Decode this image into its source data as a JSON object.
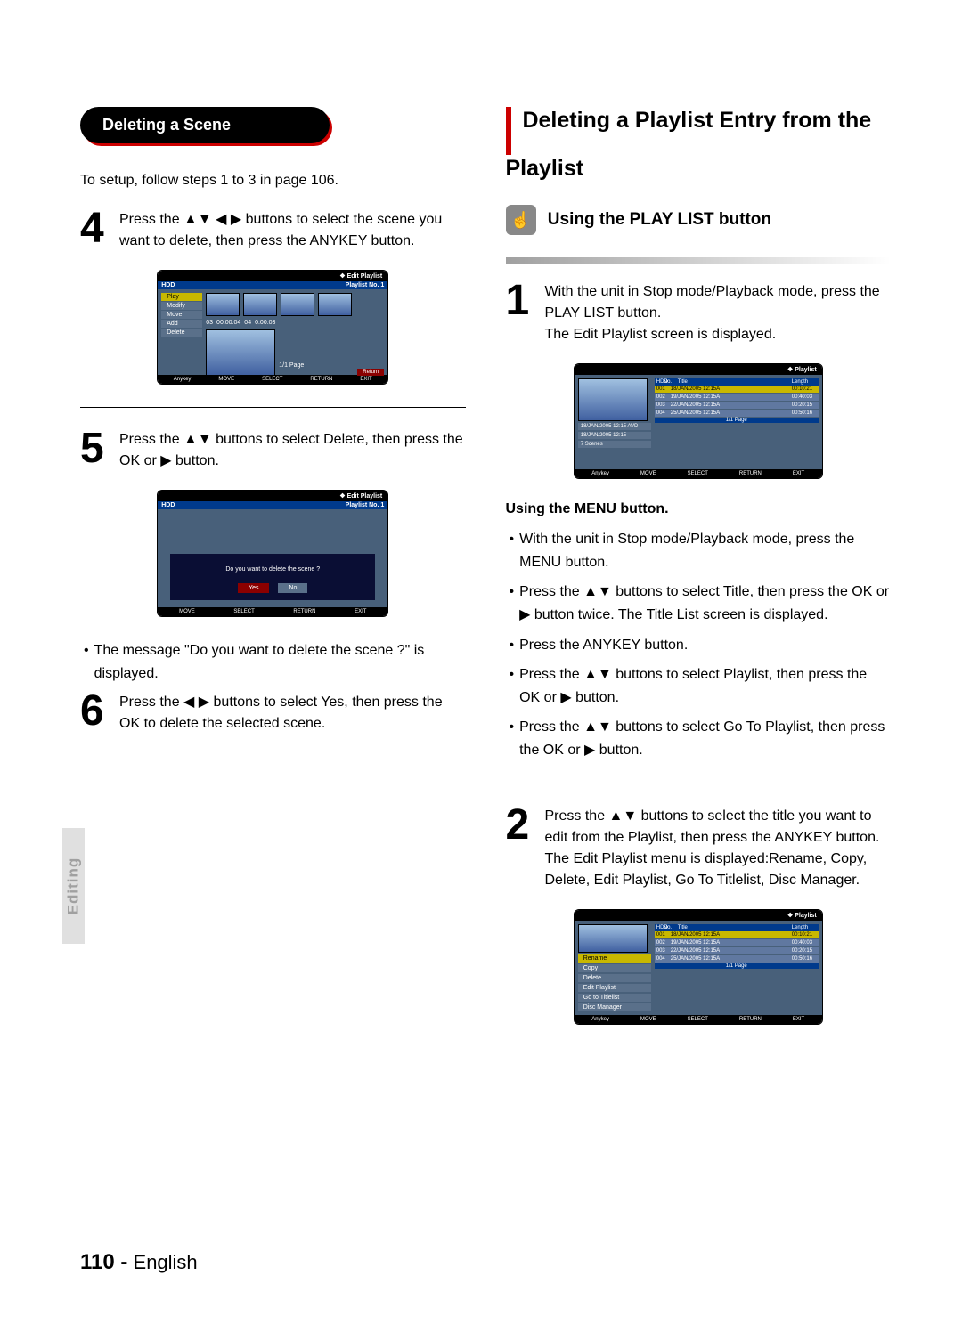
{
  "sidebar": {
    "label": "Editing"
  },
  "left": {
    "heading": "Deleting a Scene",
    "intro": "To setup, follow steps 1 to 3 in page 106.",
    "step4": {
      "num": "4",
      "text": "Press the ▲▼ ◀ ▶ buttons to select the scene you want to delete, then press the ANYKEY button."
    },
    "ss4": {
      "title": "Edit Playlist",
      "hdd": "HDD",
      "plno": "Playlist No. 1",
      "menu": [
        "Play",
        "Modify",
        "Move",
        "Add",
        "Delete"
      ],
      "page": "1/1 Page",
      "time1": "03",
      "time2": "00:00:04",
      "time3": "04",
      "time4": "0:00:03",
      "return_btn": "Return",
      "foot": {
        "anykey": "Anykey",
        "move": "MOVE",
        "select": "SELECT",
        "return": "RETURN",
        "exit": "EXIT"
      }
    },
    "step5": {
      "num": "5",
      "text": "Press the ▲▼ buttons to select Delete, then press the OK or ▶ button."
    },
    "ss5": {
      "title": "Edit Playlist",
      "hdd": "HDD",
      "plno": "Playlist No. 1",
      "prompt": "Do you want to delete the scene ?",
      "yes": "Yes",
      "no": "No",
      "foot": {
        "move": "MOVE",
        "select": "SELECT",
        "return": "RETURN",
        "exit": "EXIT"
      }
    },
    "step5_after": "The message \"Do you want to delete the scene ?\" is displayed.",
    "step6": {
      "num": "6",
      "text": "Press the ◀ ▶ buttons to select Yes, then press the OK to delete the selected scene."
    }
  },
  "right": {
    "heading": "Deleting a Playlist Entry from the Playlist",
    "hand_icon_name": "touch-icon",
    "section_title": "Using the PLAY LIST button",
    "step1": {
      "num": "1",
      "line1": "With the unit in Stop mode/Playback mode, press the PLAY LIST button.",
      "line2": "The Edit Playlist screen is displayed."
    },
    "ss1": {
      "title": "Playlist",
      "hdd": "HDD",
      "cols": {
        "no": "No.",
        "title": "Title",
        "length": "Length"
      },
      "rows": [
        {
          "no": "001",
          "title": "18/JAN/2005 12:15A",
          "len": "00:10:21",
          "sel": true
        },
        {
          "no": "002",
          "title": "19/JAN/2005 12:15A",
          "len": "00:40:03"
        },
        {
          "no": "003",
          "title": "22/JAN/2005 12:15A",
          "len": "00:20:15"
        },
        {
          "no": "004",
          "title": "25/JAN/2005 12:15A",
          "len": "00:50:16"
        }
      ],
      "meta": [
        "18/JAN/2005 12:15 AVD",
        "18/JAN/2005 12:15",
        "7 Scenes"
      ],
      "page": "1/1 Page",
      "foot": {
        "anykey": "Anykey",
        "move": "MOVE",
        "select": "SELECT",
        "return": "RETURN",
        "exit": "EXIT"
      }
    },
    "menu_heading": "Using the MENU button.",
    "menu_bullets": [
      "With the unit in Stop mode/Playback mode, press the MENU button.",
      "Press the ▲▼ buttons to select Title, then press the OK or ▶ button twice. The Title List screen is displayed.",
      "Press the ANYKEY button.",
      "Press the ▲▼ buttons to select Playlist, then press the OK or ▶ button.",
      "Press the ▲▼ buttons to select Go To Playlist, then press the OK or ▶ button."
    ],
    "step2": {
      "num": "2",
      "line1": "Press the ▲▼ buttons to select the title you want to edit from the Playlist, then press the ANYKEY button.",
      "line2": "The Edit Playlist menu is displayed:Rename, Copy, Delete, Edit Playlist, Go To Titlelist, Disc Manager."
    },
    "ss2": {
      "title": "Playlist",
      "hdd": "HDD",
      "cols": {
        "no": "No.",
        "title": "Title",
        "length": "Length"
      },
      "rows": [
        {
          "no": "001",
          "title": "18/JAN/2005 12:15A",
          "len": "00:10:21",
          "sel": true
        },
        {
          "no": "002",
          "title": "19/JAN/2005 12:15A",
          "len": "00:40:03"
        },
        {
          "no": "003",
          "title": "22/JAN/2005 12:15A",
          "len": "00:20:15"
        },
        {
          "no": "004",
          "title": "25/JAN/2005 12:15A",
          "len": "00:50:16"
        }
      ],
      "menu": [
        "Rename",
        "Copy",
        "Delete",
        "Edit Playlist",
        "Go to Titlelist",
        "Disc Manager"
      ],
      "page": "1/1 Page",
      "foot": {
        "anykey": "Anykey",
        "move": "MOVE",
        "select": "SELECT",
        "return": "RETURN",
        "exit": "EXIT"
      }
    }
  },
  "footer": {
    "page": "110 -",
    "lang": "English"
  }
}
